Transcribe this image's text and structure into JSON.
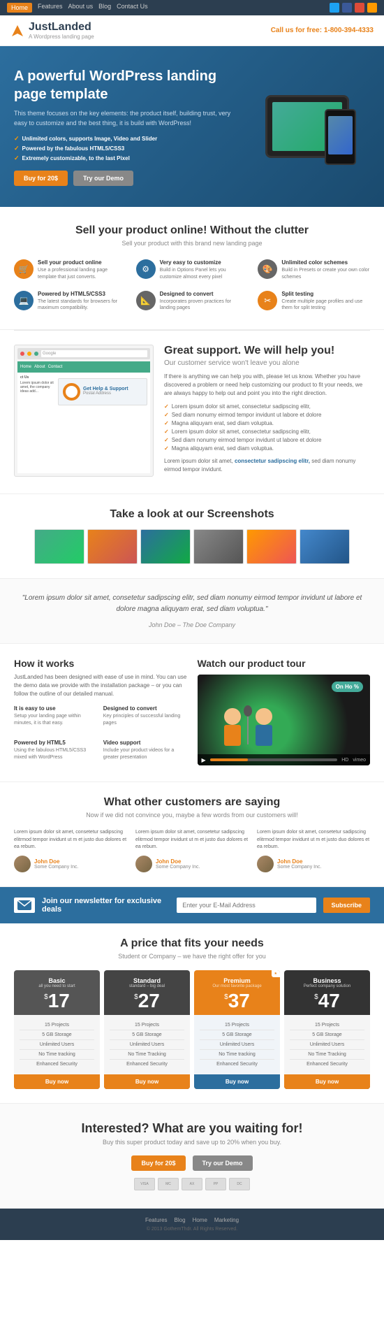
{
  "nav": {
    "links": [
      "Home",
      "Features",
      "About us",
      "Blog",
      "Contact Us"
    ],
    "active": "Home"
  },
  "header": {
    "logo_name": "JustLanded",
    "logo_sub": "A Wordpress landing page",
    "phone_label": "Call us for free:",
    "phone": "1-800-394-4333"
  },
  "hero": {
    "title": "A powerful WordPress landing page template",
    "description": "This theme focuses on the key elements: the product itself, building trust, very easy to customize and the best thing, it is build with WordPress!",
    "features": [
      "Unlimited colors, supports Image, Video and Slider",
      "Powered by the fabulous HTML5/CSS3",
      "Extremely customizable, to the last Pixel"
    ],
    "btn_buy": "Buy for 20$",
    "btn_demo": "Try our Demo"
  },
  "sell": {
    "title": "Sell your product online! Without the clutter",
    "subtitle": "Sell your product with this brand new landing page",
    "features": [
      {
        "icon": "🛒",
        "title": "Sell your product online",
        "desc": "Use a professional landing page template that just converts."
      },
      {
        "icon": "🎨",
        "title": "Very easy to customize",
        "desc": "Build in Options Panel lets you customize almost every pixel"
      },
      {
        "icon": "🎨",
        "title": "Unlimited color schemes",
        "desc": "Build in Presets or create your own color schemes"
      },
      {
        "icon": "💻",
        "title": "Powered by HTML5/CSS3",
        "desc": "The latest standards for browsers for maximum compatibility."
      },
      {
        "icon": "📐",
        "title": "Designed to convert",
        "desc": "Incorporates proven practices for landing pages"
      },
      {
        "icon": "✂️",
        "title": "Split testing",
        "desc": "Create multiple page profiles and use them for split testing"
      }
    ]
  },
  "support": {
    "title": "Great support. We will help you!",
    "subtitle": "Our customer service won't leave you alone",
    "description": "If there is anything we can help you with, please let us know. Whether you have discovered a problem or need help customizing our product to fit your needs, we are always happy to help out and point you into the right direction.",
    "checklist": [
      "Lorem ipsum dolor sit amet, consectetur sadipscing elitr,",
      "Sed diam nonumy eirmod tempor invidunt ut labore et dolore",
      "Magna aliquyam erat, sed diam voluptua.",
      "Lorem ipsum dolor sit amet, consectetur sadipscing elitr,",
      "Sed diam nonumy eirmod tempor invidunt ut labore et dolore",
      "Magna aliquyam erat, sed diam voluptua."
    ],
    "bottom_text": "Lorem ipsum dolor sit amet, consectetur sadipscing elitr, sed diam nonumy eirmod tempor invidunt.",
    "bottom_bold": "consectetur sadipscing elitr,",
    "help_title": "Get Help & Support",
    "help_desc": "Postal Address"
  },
  "screenshots": {
    "title": "Take a look at our Screenshots"
  },
  "testimonial": {
    "quote": "\"Lorem ipsum dolor sit amet, consetetur sadipscing elitr, sed diam nonumy eirmod tempor invidunt ut labore et dolore magna aliquyam erat, sed diam voluptua.\"",
    "name": "John Doe",
    "company": "The Doe Company"
  },
  "howItWorks": {
    "title": "How it works",
    "description": "JustLanded has been designed with ease of use in mind. You can use the demo data we provide with the installation package – or you can follow the outline of our detailed manual.",
    "features": [
      {
        "title": "It is easy to use",
        "desc": "Setup your landing page within minutes, it is that easy."
      },
      {
        "title": "Designed to convert",
        "desc": "Key principles of successful landing pages"
      },
      {
        "title": "Powered by HTML5",
        "desc": "Using the fabulous HTML5/CSS3 mixed with WordPress"
      },
      {
        "title": "Video support",
        "desc": "Include your product videos for a greater presentation"
      }
    ]
  },
  "productTour": {
    "title": "Watch our product tour",
    "on_air": "On Ho %",
    "hd_label": "HD",
    "vimeo": "vimeo"
  },
  "customers": {
    "title": "What other customers are saying",
    "subtitle": "Now if we did not convince you, maybe a few words from our customers will!",
    "testimonials": [
      {
        "text": "Lorem ipsum dolor sit amet, consetetur sadipscing elitrmod tempor invidunt ut m et justo duo dolores et ea rebum.",
        "name": "John Doe",
        "company": "Some Company Inc."
      },
      {
        "text": "Lorem ipsum dolor sit amet, consetetur sadipscing elitrmod tempor invidunt ut m et justo duo dolores et ea rebum.",
        "name": "John Doe",
        "company": "Some Company Inc."
      },
      {
        "text": "Lorem ipsum dolor sit amet, consetetur sadipscing elitrmod tempor invidunt ut m et justo duo dolores et ea rebum.",
        "name": "John Doe",
        "company": "Some Company Inc."
      }
    ]
  },
  "newsletter": {
    "text": "Join our newsletter for exclusive deals",
    "placeholder": "Enter your E-Mail Address",
    "btn_label": "Subscribe"
  },
  "pricing": {
    "title": "A price that fits your needs",
    "subtitle": "Student or Company – we have the right offer for you",
    "plans": [
      {
        "name": "Basic",
        "sub": "all you need to start",
        "price": "17",
        "ribbon": "",
        "type": "basic",
        "features": [
          "15 Projects",
          "5 GB Storage",
          "Unlimited Users",
          "No Time tracking",
          "Enhanced Security"
        ],
        "btn": "Buy now"
      },
      {
        "name": "Standard",
        "sub": "standard – big deal",
        "price": "27",
        "ribbon": "",
        "type": "standard",
        "features": [
          "15 Projects",
          "5 GB Storage",
          "Unlimited Users",
          "No Time Tracking",
          "Enhanced Security"
        ],
        "btn": "Buy now"
      },
      {
        "name": "Premium",
        "sub": "Our most favorite package",
        "price": "37",
        "ribbon": "★",
        "type": "premium",
        "features": [
          "15 Projects",
          "5 GB Storage",
          "Unlimited Users",
          "No Time tracking",
          "Enhanced Security"
        ],
        "btn": "Buy now"
      },
      {
        "name": "Business",
        "sub": "Perfect company solution",
        "price": "47",
        "ribbon": "",
        "type": "business",
        "features": [
          "15 Projects",
          "5 GB Storage",
          "Unlimited Users",
          "No Time Tracking",
          "Enhanced Security"
        ],
        "btn": "Buy now"
      }
    ]
  },
  "cta": {
    "title": "Interested? What are you waiting for!",
    "subtitle": "Buy this super product today and save up to 20% when you buy.",
    "btn_buy": "Buy for 20$",
    "btn_demo": "Try our Demo"
  },
  "footer": {
    "links": [
      "Features",
      "Blog",
      "Home",
      "Marketing"
    ],
    "copyright": "© 2013 GothemThdr. All Rights Reserved."
  }
}
